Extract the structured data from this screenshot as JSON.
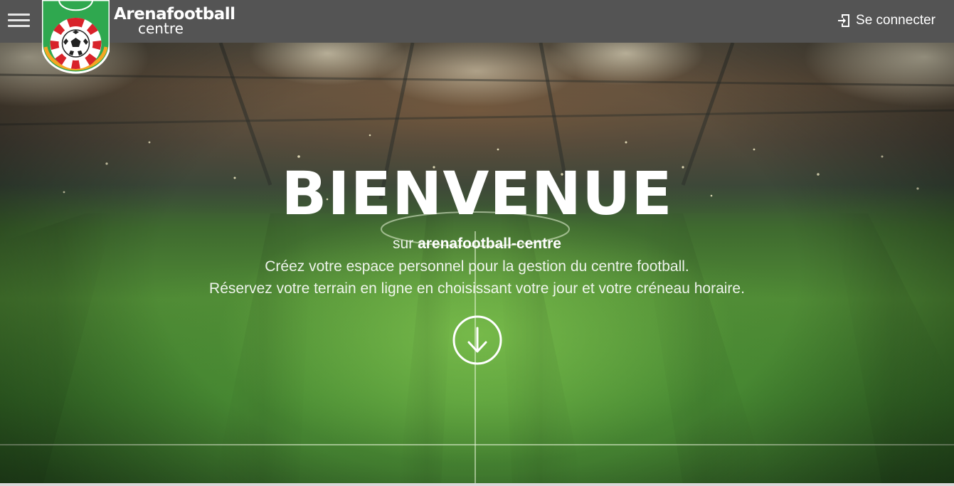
{
  "header": {
    "brand_name": "Arenafootball",
    "brand_sub": "centre",
    "login_label": "Se connecter"
  },
  "hero": {
    "title": "BIENVENUE",
    "subtitle_prefix": "sur",
    "subtitle_site": "arenafootball-centre",
    "line1": "Créez votre espace personnel pour la gestion du centre football.",
    "line2": "Réservez votre terrain en ligne en choisissant votre jour et votre créneau horaire."
  },
  "icons": {
    "menu": "hamburger-menu-icon",
    "logo": "soccer-ball-logo-icon",
    "login": "sign-in-icon",
    "scroll": "arrow-down-circle-icon"
  },
  "colors": {
    "topbar": "#545454",
    "text": "#ffffff",
    "logo_green": "#2fa84f",
    "logo_red": "#d8232a",
    "logo_orange": "#f4a623"
  }
}
